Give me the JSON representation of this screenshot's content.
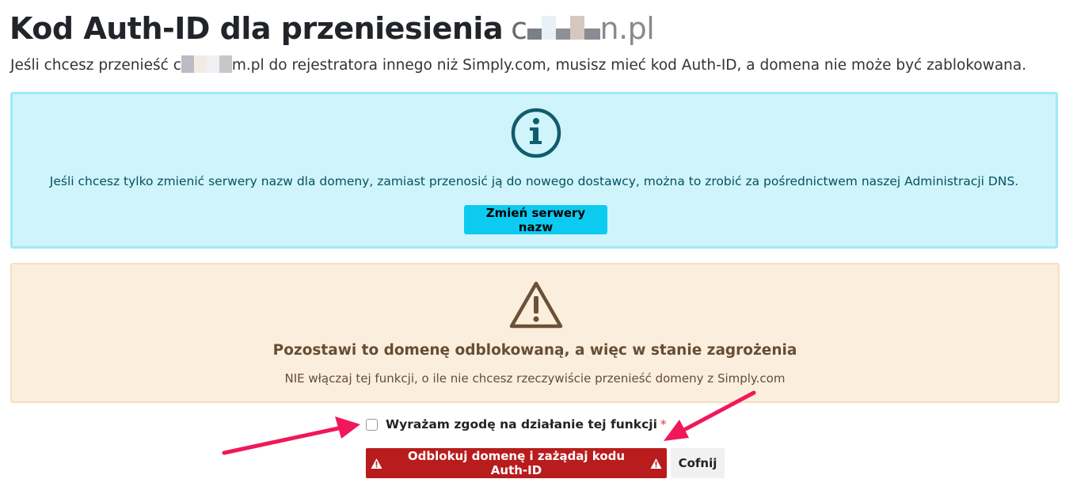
{
  "header": {
    "title": "Kod Auth-ID dla przeniesienia",
    "domain_prefix": "c",
    "domain_suffix": "n.pl"
  },
  "intro": {
    "before_domain": "Jeśli chcesz przenieść c",
    "after_domain": "m.pl do rejestratora innego niż Simply.com, musisz mieć kod Auth-ID, a domena nie może być zablokowana."
  },
  "info_box": {
    "icon": "info-circle-icon",
    "text": "Jeśli chcesz tylko zmienić serwery nazw dla domeny, zamiast przenosić ją do nowego dostawcy, można to zrobić za pośrednictwem naszej Administracji DNS.",
    "button_label": "Zmień serwery nazw",
    "bg_color": "#cff4fc",
    "accent_color": "#0dcaf0"
  },
  "warning_box": {
    "icon": "warning-triangle-icon",
    "heading": "Pozostawi to domenę odblokowaną, a więc w stanie zagrożenia",
    "text": "NIE włączaj tej funkcji, o ile nie chcesz rzeczywiście przenieść domeny z Simply.com",
    "bg_color": "#fbeedd"
  },
  "consent": {
    "label": "Wyrażam zgodę na działanie tej funkcji",
    "required_mark": "*",
    "checked": false
  },
  "actions": {
    "unlock_label": "Odblokuj domenę i zażądaj kodu Auth-ID",
    "back_label": "Cofnij",
    "unlock_color": "#b91c1c"
  },
  "annotations": {
    "arrow_color": "#f0185a"
  }
}
